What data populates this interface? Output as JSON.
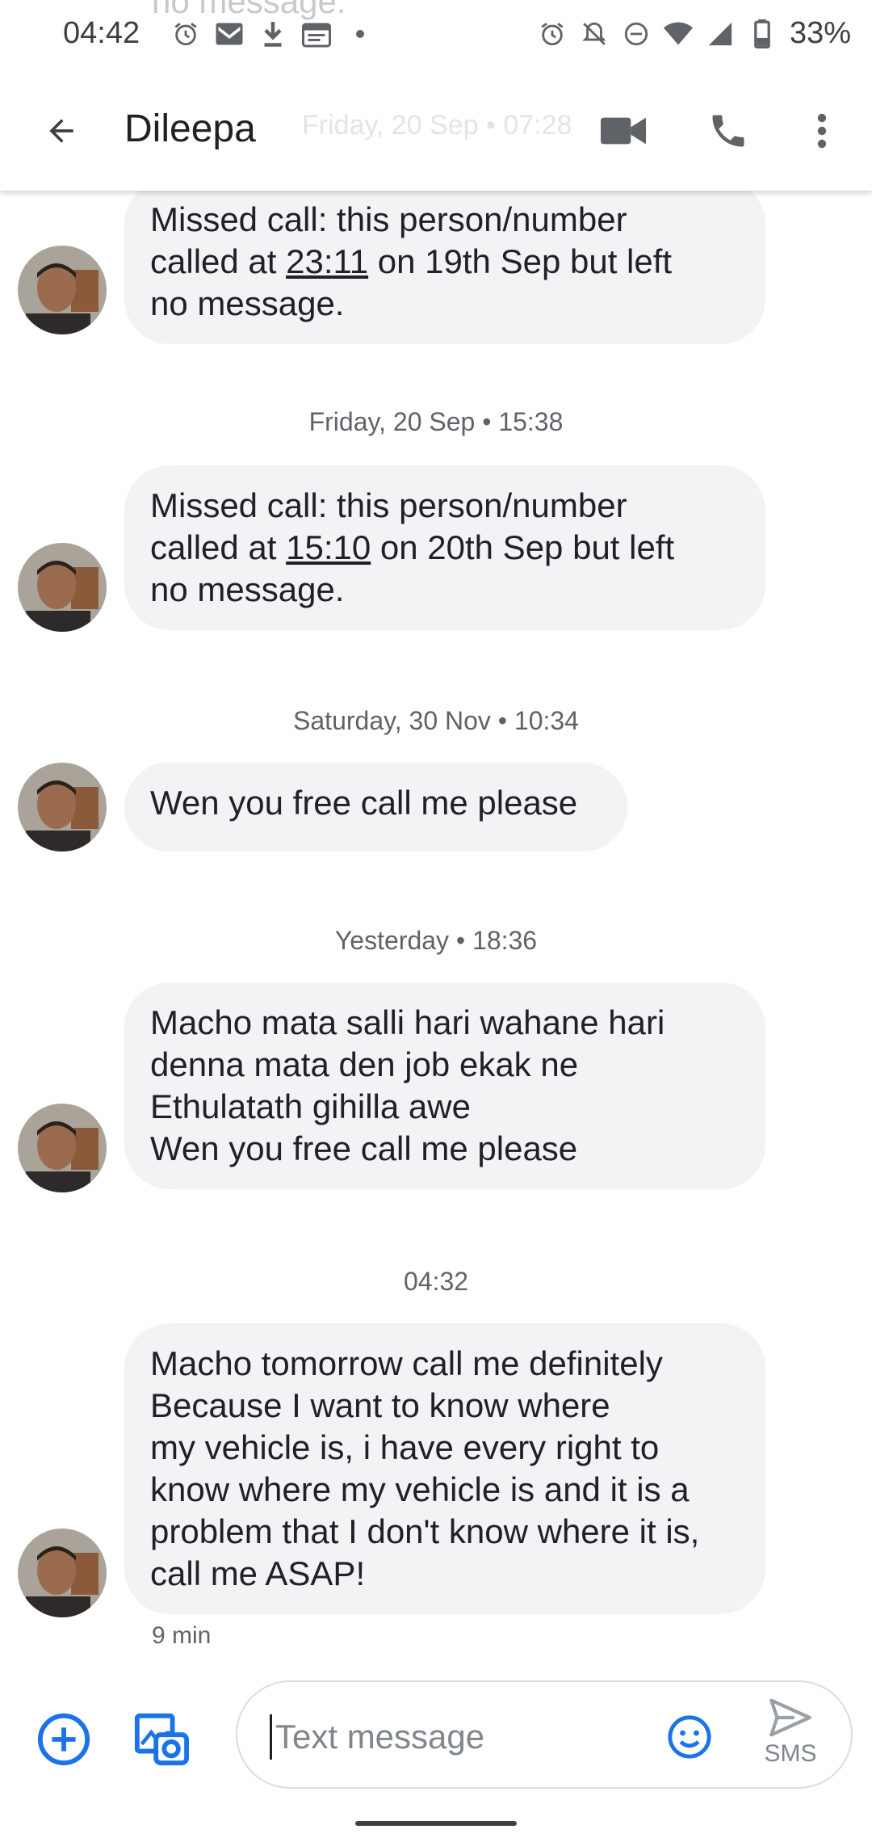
{
  "status_bar": {
    "time": "04:42",
    "battery_percent": "33%",
    "left_icons": [
      "alarm-icon",
      "gmail-icon",
      "download-icon",
      "calendar-icon",
      "dot-icon"
    ],
    "right_icons": [
      "alarm-icon",
      "notifications-off-icon",
      "do-not-disturb-icon",
      "wifi-icon",
      "signal-icon",
      "battery-icon"
    ]
  },
  "ghost_text": "no message.",
  "app_bar": {
    "contact_name": "Dileepa",
    "faded_header": "Friday, 20 Sep • 07:28",
    "actions": [
      "back-arrow-icon",
      "video-call-icon",
      "phone-call-icon",
      "more-vert-icon"
    ]
  },
  "conversation": {
    "messages": [
      {
        "lines": [
          {
            "parts": [
              "Missed call: this person/number"
            ]
          },
          {
            "pre": "called at ",
            "link": "23:11",
            "post": " on 19th Sep but left"
          },
          {
            "parts": [
              "no message."
            ]
          }
        ]
      },
      {
        "divider": "Friday, 20 Sep • 15:38",
        "lines": [
          {
            "parts": [
              "Missed call: this person/number"
            ]
          },
          {
            "pre": "called at ",
            "link": "15:10",
            "post": " on 20th Sep but left"
          },
          {
            "parts": [
              "no message."
            ]
          }
        ]
      },
      {
        "divider": "Saturday, 30 Nov • 10:34",
        "lines": [
          {
            "parts": [
              "Wen you free call me please"
            ]
          }
        ]
      },
      {
        "divider": "Yesterday • 18:36",
        "lines": [
          {
            "parts": [
              "Macho mata salli hari wahane hari"
            ]
          },
          {
            "parts": [
              "denna mata den job ekak ne"
            ]
          },
          {
            "parts": [
              "Ethulatath gihilla awe"
            ]
          },
          {
            "parts": [
              "Wen you free call me please"
            ]
          }
        ]
      },
      {
        "divider": "04:32",
        "lines": [
          {
            "parts": [
              "Macho tomorrow call me definitely"
            ]
          },
          {
            "parts": [
              "Because I want to know where"
            ]
          },
          {
            "parts": [
              "my vehicle is, i have every right to"
            ]
          },
          {
            "parts": [
              "know where my vehicle is and it is a"
            ]
          },
          {
            "parts": [
              "problem that I don't know where it is,"
            ]
          },
          {
            "parts": [
              "call me ASAP!"
            ]
          }
        ],
        "meta": "9 min"
      }
    ]
  },
  "compose": {
    "placeholder": "Text message",
    "send_label": "SMS",
    "icons": [
      "add-circle-icon",
      "gallery-icon",
      "emoji-icon",
      "send-icon"
    ]
  },
  "colors": {
    "accent": "#1a73e8",
    "bubble_bg": "#f1f3f4",
    "text": "#202124",
    "secondary_text": "#5f6368"
  }
}
